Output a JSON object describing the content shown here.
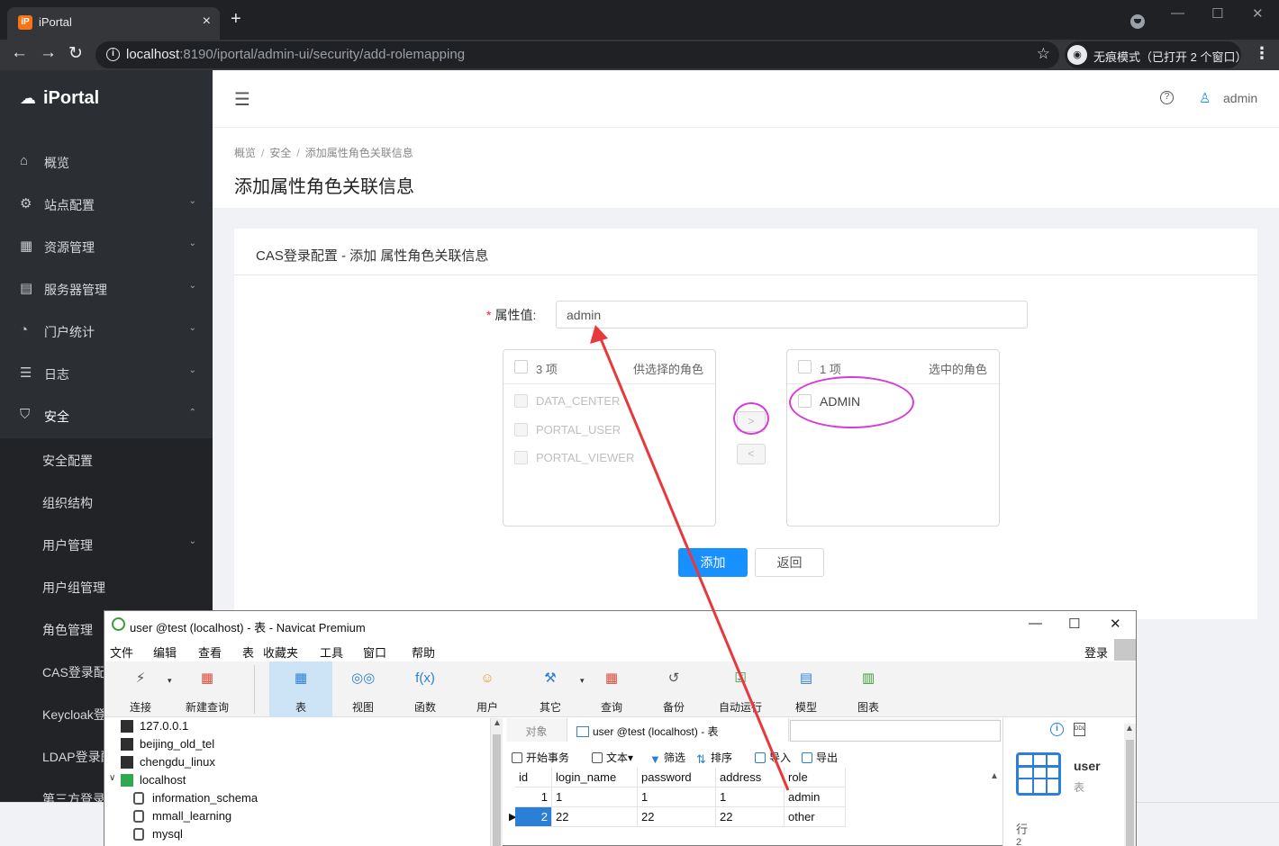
{
  "browser": {
    "tab_title": "iPortal",
    "tab_favicon": "iP",
    "close_glyph": "×",
    "newtab_glyph": "+",
    "url_host": "localhost",
    "url_path": ":8190/iportal/admin-ui/security/add-rolemapping",
    "incognito_label": "无痕模式（已打开 2 个窗口）",
    "icons": [
      "back-arrow-icon",
      "forward-arrow-icon",
      "reload-icon",
      "info-icon",
      "star-icon",
      "incognito-icon",
      "menu-dots-icon"
    ]
  },
  "app": {
    "name": "iPortal",
    "user": "admin",
    "sidebar": [
      {
        "label": "概览",
        "icon": "home-icon",
        "arrow": ""
      },
      {
        "label": "站点配置",
        "icon": "gear-icon",
        "arrow": "⌄"
      },
      {
        "label": "资源管理",
        "icon": "grid-icon",
        "arrow": "⌄"
      },
      {
        "label": "服务器管理",
        "icon": "server-icon",
        "arrow": "⌄"
      },
      {
        "label": "门户统计",
        "icon": "dashboard-icon",
        "arrow": "⌄"
      },
      {
        "label": "日志",
        "icon": "log-icon",
        "arrow": "⌄"
      },
      {
        "label": "安全",
        "icon": "shield-icon",
        "arrow": "⌃"
      }
    ],
    "submenu": [
      {
        "label": "安全配置",
        "arrow": ""
      },
      {
        "label": "组织结构",
        "arrow": ""
      },
      {
        "label": "用户管理",
        "arrow": "⌄"
      },
      {
        "label": "用户组管理",
        "arrow": ""
      },
      {
        "label": "角色管理",
        "arrow": ""
      },
      {
        "label": "CAS登录配",
        "arrow": ""
      },
      {
        "label": "Keycloak登",
        "arrow": ""
      },
      {
        "label": "LDAP登录配",
        "arrow": ""
      },
      {
        "label": "第三方登录",
        "arrow": ""
      }
    ],
    "breadcrumb": [
      "概览",
      "安全",
      "添加属性角色关联信息"
    ],
    "breadcrumb_sep": "/",
    "page_title": "添加属性角色关联信息",
    "card_title": "CAS登录配置 - 添加 属性角色关联信息",
    "form": {
      "required_mark": "*",
      "label": "属性值:",
      "value": "admin"
    },
    "transfer": {
      "left": {
        "count": "3 项",
        "title": "供选择的角色",
        "items": [
          "DATA_CENTER",
          "PORTAL_USER",
          "PORTAL_VIEWER"
        ]
      },
      "right": {
        "count": "1 项",
        "title": "选中的角色",
        "items": [
          "ADMIN"
        ]
      },
      "move_right": ">",
      "move_left": "<"
    },
    "buttons": {
      "add": "添加",
      "back": "返回"
    },
    "accent_color": "#1890ff",
    "sidebar_color": "#2b2e33"
  },
  "navicat": {
    "title": "user @test (localhost) - 表 - Navicat Premium",
    "window_controls": [
      "—",
      "☐",
      "✕"
    ],
    "menus": [
      "文件",
      "编辑",
      "查看",
      "表",
      "收藏夹",
      "工具",
      "窗口",
      "帮助"
    ],
    "login": "登录",
    "toolbar": [
      {
        "label": "连接",
        "icon": "connect-icon"
      },
      {
        "label": "新建查询",
        "icon": "new-query-icon"
      },
      {
        "label": "表",
        "icon": "table-icon"
      },
      {
        "label": "视图",
        "icon": "view-icon"
      },
      {
        "label": "函数",
        "icon": "function-icon"
      },
      {
        "label": "用户",
        "icon": "user-icon"
      },
      {
        "label": "其它",
        "icon": "other-icon"
      },
      {
        "label": "查询",
        "icon": "query-icon"
      },
      {
        "label": "备份",
        "icon": "backup-icon"
      },
      {
        "label": "自动运行",
        "icon": "auto-run-icon"
      },
      {
        "label": "模型",
        "icon": "model-icon"
      },
      {
        "label": "图表",
        "icon": "chart-icon"
      }
    ],
    "function_glyph": "f(x)",
    "dropdown_glyph": "▾",
    "tree": [
      {
        "label": "127.0.0.1",
        "type": "conn"
      },
      {
        "label": "beijing_old_tel",
        "type": "conn"
      },
      {
        "label": "chengdu_linux",
        "type": "conn"
      },
      {
        "label": "localhost",
        "type": "conn-open"
      },
      {
        "label": "information_schema",
        "type": "db"
      },
      {
        "label": "mmall_learning",
        "type": "db"
      },
      {
        "label": "mysql",
        "type": "db"
      }
    ],
    "tabs": {
      "objects": "对象",
      "table": "user @test (localhost) - 表"
    },
    "subbar": [
      "开始事务",
      "文本",
      "筛选",
      "排序",
      "导入",
      "导出"
    ],
    "grid": {
      "columns": [
        "id",
        "login_name",
        "password",
        "address",
        "role"
      ],
      "rows": [
        [
          "1",
          "1",
          "1",
          "1",
          "admin"
        ],
        [
          "2",
          "22",
          "22",
          "22",
          "other"
        ]
      ],
      "row_marker": "▶"
    },
    "info": {
      "name": "user",
      "type": "表",
      "rows_label": "行",
      "rows_value": "2"
    }
  },
  "annotations": {
    "arrow_color": "#e8383d",
    "ellipse_color": "#d63ad8"
  }
}
